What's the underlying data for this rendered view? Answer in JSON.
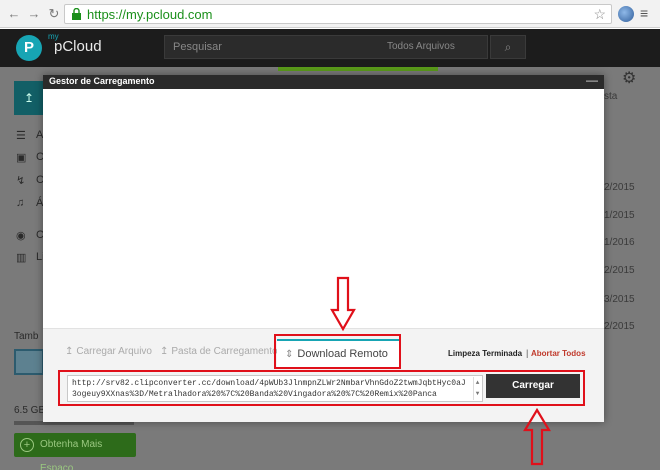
{
  "browser": {
    "url": "https://my.pcloud.com",
    "back_icon": "←",
    "forward_icon": "→",
    "reload_icon": "↻",
    "star_icon": "☆",
    "menu_icon": "≡"
  },
  "app": {
    "logo_my": "my",
    "logo_name": "pCloud",
    "logo_letter": "P",
    "search_placeholder": "Pesquisar",
    "search_filter": "Todos Arquivos",
    "dates": [
      "2/2015",
      "1/2015",
      "2/2015",
      "1/2016",
      "2/2015",
      "3/2015",
      "2/2015",
      "2/2015"
    ],
    "sidebar_letters": [
      "A",
      "C",
      "C",
      "Á",
      "C",
      "Li"
    ],
    "bottom_label": "Tamb",
    "storage_label": "6.5 GB",
    "get_more_label": "Obtenha Mais Espaço",
    "right_btn_label": "sta"
  },
  "modal": {
    "title": "Gestor de Carregamento",
    "minimize_icon": "—",
    "tabs": {
      "upload_file": "Carregar Arquivo",
      "upload_folder": "Pasta de Carregamento",
      "remote_download": "Download Remoto"
    },
    "clean_done": "Limpeza Terminada",
    "separator": "|",
    "abort_all": "Abortar Todos",
    "url_value": "http://srv82.clipconverter.cc/download/4pWUb3JlnmpnZLWr2NmbarVhnGdoZ2twmJqbtHyc0aJ3ogeuy9XXnas%3D/Metralhadora%20%7C%20Banda%20Vingadora%20%7C%20Remix%20Panca",
    "upload_button": "Carregar"
  },
  "annotation_color": "#e0101a"
}
